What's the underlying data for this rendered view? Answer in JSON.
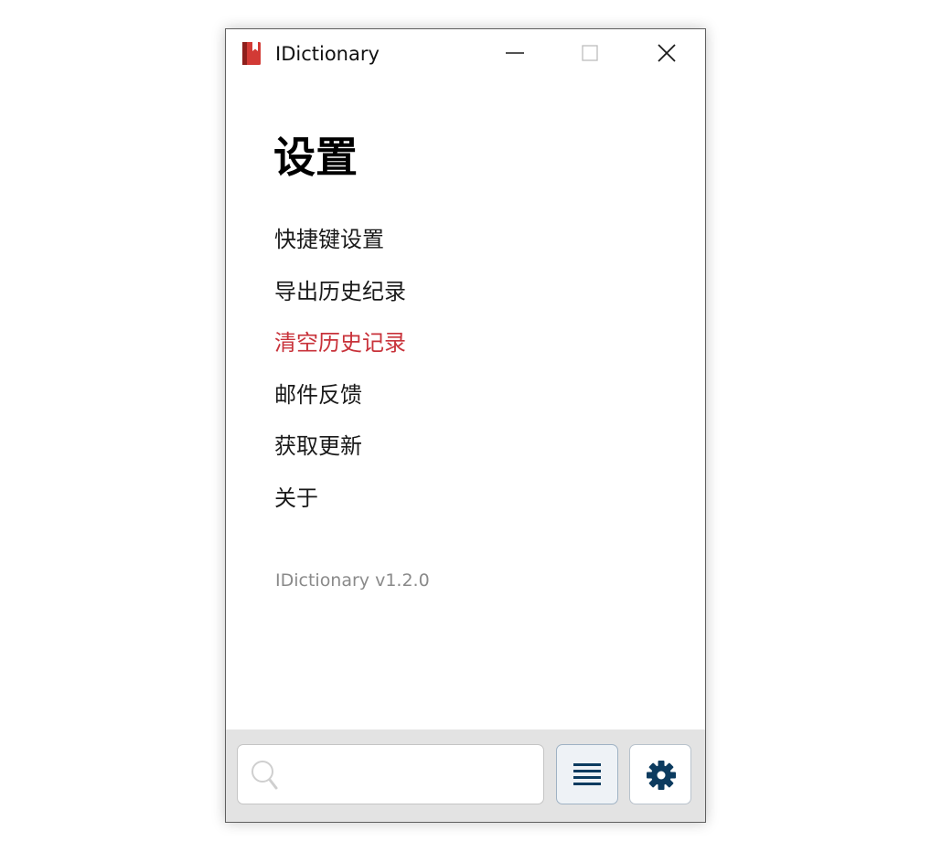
{
  "window": {
    "title": "IDictionary",
    "app_icon": "book-icon",
    "controls": {
      "minimize_icon": "minimize-icon",
      "maximize_icon": "maximize-icon",
      "close_icon": "close-icon"
    }
  },
  "settings": {
    "title": "设置",
    "items": [
      {
        "label": "快捷键设置"
      },
      {
        "label": "导出历史纪录"
      },
      {
        "label": "清空历史记录",
        "danger": true
      },
      {
        "label": "邮件反馈"
      },
      {
        "label": "获取更新"
      },
      {
        "label": "关于"
      }
    ],
    "version": "IDictionary v1.2.0"
  },
  "bottom_bar": {
    "search": {
      "value": "",
      "placeholder": "",
      "icon": "search-icon"
    },
    "list_button_icon": "list-icon",
    "settings_button_icon": "gear-icon"
  },
  "colors": {
    "danger": "#c8323a",
    "accent": "#0c3b5f",
    "app_icon_red": "#d23a35",
    "bottom_bar_bg": "#e3e3e3",
    "version_text": "#8a8a8a"
  }
}
